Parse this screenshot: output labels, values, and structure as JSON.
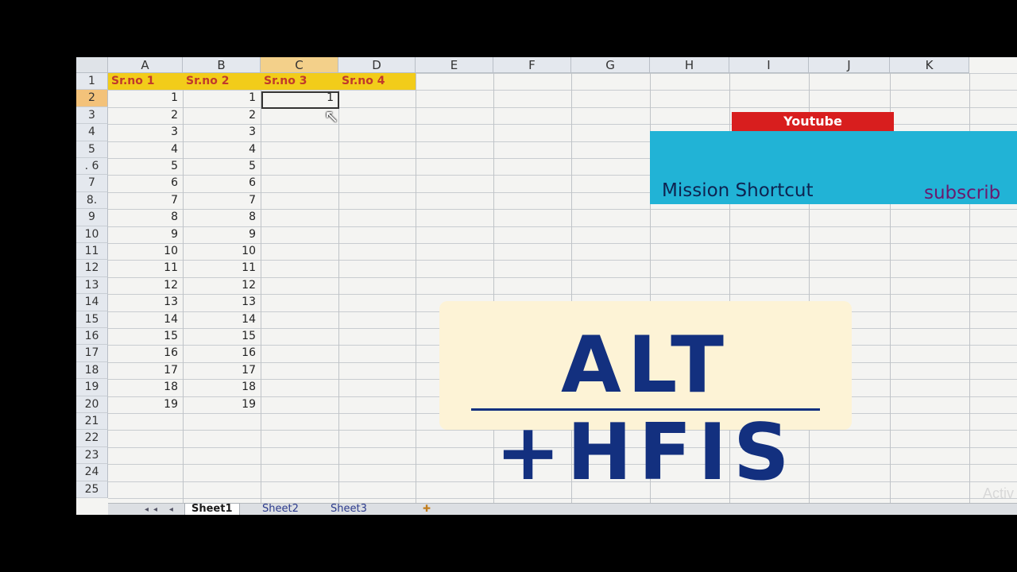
{
  "sheet": {
    "columns": [
      "A",
      "B",
      "C",
      "D",
      "E",
      "F",
      "G",
      "H",
      "I",
      "J",
      "K"
    ],
    "selected_column": "C",
    "rows": [
      "1",
      "2",
      "3",
      "4",
      "5",
      ". 6",
      "7",
      "8.",
      "9",
      "10",
      "11",
      "12",
      "13",
      "14",
      "15",
      "16",
      "17",
      "18",
      "19",
      "20",
      "21",
      "22",
      "23",
      "24",
      "25"
    ],
    "selected_row": "2",
    "headers": [
      "Sr.no   1",
      "Sr.no  2",
      "Sr.no   3",
      "Sr.no    4"
    ],
    "col_a_values": [
      "1",
      "2",
      "3",
      "4",
      "5",
      "6",
      "7",
      "8",
      "9",
      "10",
      "11",
      "12",
      "13",
      "14",
      "15",
      "16",
      "17",
      "18",
      "19"
    ],
    "col_b_values": [
      "1",
      "2",
      "3",
      "4",
      "5",
      "6",
      "7",
      "8",
      "9",
      "10",
      "11",
      "12",
      "13",
      "14",
      "15",
      "16",
      "17",
      "18",
      "19"
    ],
    "col_c_values": [
      "1"
    ],
    "header_color": "#f2cc1a"
  },
  "banner": {
    "youtube_label": "Youtube",
    "mission_text": "Mission Shortcut",
    "subscribe_text": "subscrib",
    "youtube_color": "#d81e1e",
    "box_color": "#21b3d6"
  },
  "tabs": {
    "items": [
      "Sheet1",
      "Sheet2",
      "Sheet3"
    ],
    "active": "Sheet1",
    "nav_arrows": "◂◂ ◂ ▸ ▸▸"
  },
  "overlay": {
    "shortcut_text": "ALT +HFIS",
    "bg_color": "#fdf3d6",
    "text_color": "#13307f"
  },
  "watermark": {
    "text": "Activ"
  }
}
